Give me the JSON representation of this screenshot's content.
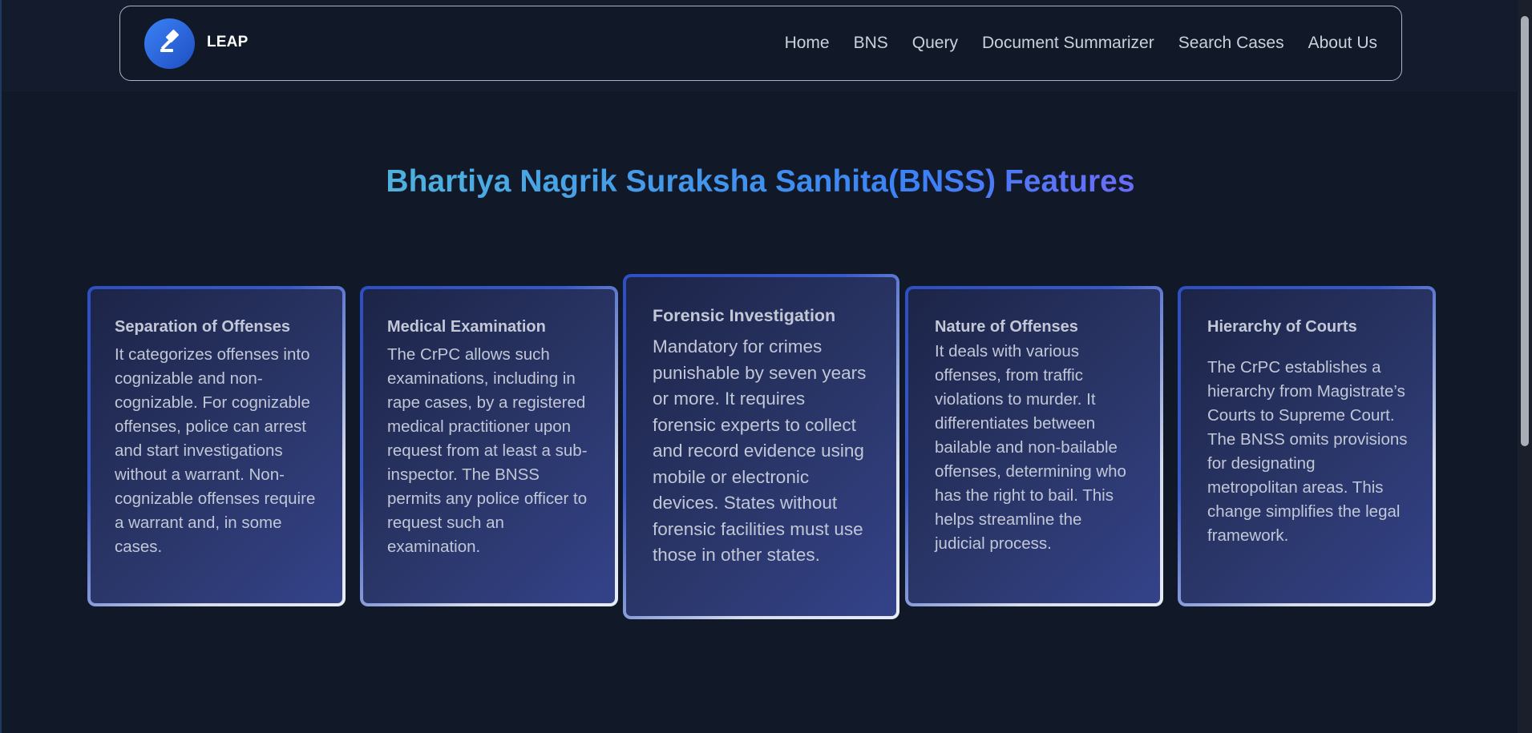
{
  "app": {
    "logo_text": "LEAP"
  },
  "nav": {
    "items": [
      {
        "label": "Home"
      },
      {
        "label": "BNS"
      },
      {
        "label": "Query"
      },
      {
        "label": "Document Summarizer"
      },
      {
        "label": "Search Cases"
      },
      {
        "label": "About Us"
      }
    ]
  },
  "main": {
    "heading": "Bhartiya Nagrik Suraksha Sanhita(BNSS) Features",
    "cards": [
      {
        "title": "Separation of Offenses",
        "body": "It categorizes offenses into cognizable and non-cognizable. For cognizable offenses, police can arrest and start investigations without a warrant. Non-cognizable offenses require a warrant and, in some cases."
      },
      {
        "title": "Medical Examination",
        "body": "The CrPC allows such examinations, including in rape cases, by a registered medical practitioner upon request from at least a sub-inspector. The BNSS permits any police officer to request such an examination."
      },
      {
        "title": "Forensic Investigation",
        "body": "Mandatory for crimes punishable by seven years or more. It requires forensic experts to collect and record evidence using mobile or electronic devices. States without forensic facilities must use those in other states."
      },
      {
        "title": "Nature of Offenses",
        "body": "It deals with various offenses, from traffic violations to murder. It differentiates between bailable and non-bailable offenses, determining who has the right to bail. This helps streamline the judicial process."
      },
      {
        "title": "Hierarchy of Courts",
        "body": "The CrPC establishes a hierarchy from Magistrate’s Courts to Supreme Court. The BNSS omits provisions for designating metropolitan areas. This change simplifies the legal framework."
      }
    ]
  },
  "icons": {
    "logo": "gavel-icon"
  },
  "colors": {
    "background": "#111827",
    "logo_circle": "#3b82f6",
    "heading_gradient": [
      "#6ee7b7",
      "#3b82f6",
      "#8b5cf6"
    ],
    "card_border_blue": "#2d4fc4",
    "card_border_white": "#e8ecf5"
  }
}
